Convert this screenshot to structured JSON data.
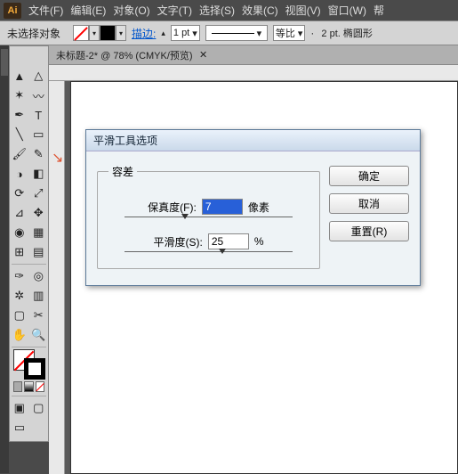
{
  "menubar": {
    "logo": "Ai",
    "items": [
      "文件(F)",
      "编辑(E)",
      "对象(O)",
      "文字(T)",
      "选择(S)",
      "效果(C)",
      "视图(V)",
      "窗口(W)",
      "帮"
    ]
  },
  "optbar": {
    "selection": "未选择对象",
    "stroke_label": "描边:",
    "stroke_weight": "1 pt",
    "proportion": "等比",
    "stroke_info": "2 pt. 椭圆形"
  },
  "doc": {
    "title": "未标题-2* @ 78% (CMYK/预览)"
  },
  "dialog": {
    "title": "平滑工具选项",
    "group_label": "容差",
    "fidelity_label": "保真度(F):",
    "fidelity_value": "7",
    "fidelity_unit": "像素",
    "smoothness_label": "平滑度(S):",
    "smoothness_value": "25",
    "smoothness_unit": "%",
    "ok": "确定",
    "cancel": "取消",
    "reset": "重置(R)"
  }
}
